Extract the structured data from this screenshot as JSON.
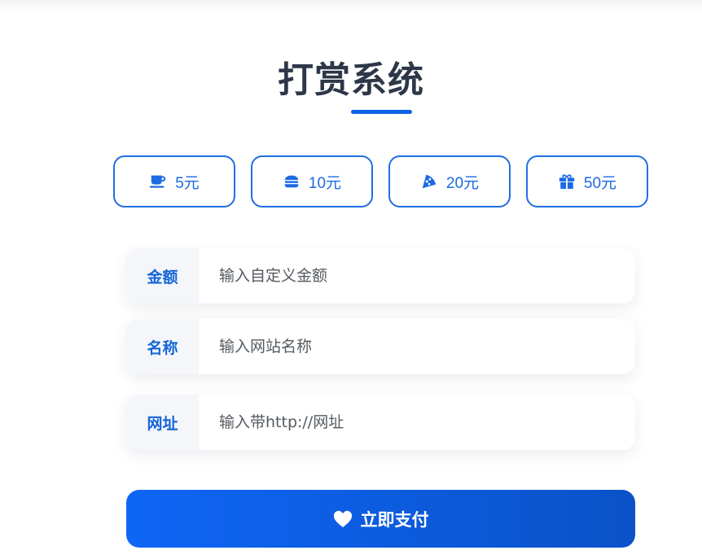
{
  "header": {
    "title": "打赏系统"
  },
  "amounts": [
    {
      "label": "5元",
      "icon": "coffee-icon"
    },
    {
      "label": "10元",
      "icon": "burger-icon"
    },
    {
      "label": "20元",
      "icon": "pizza-icon"
    },
    {
      "label": "50元",
      "icon": "gift-icon"
    }
  ],
  "form": {
    "amount": {
      "label": "金额",
      "placeholder": "输入自定义金额"
    },
    "name": {
      "label": "名称",
      "placeholder": "输入网站名称"
    },
    "url": {
      "label": "网址",
      "placeholder": "输入带http://网址"
    }
  },
  "pay_button": {
    "label": "立即支付",
    "icon": "heart-icon"
  },
  "colors": {
    "accent": "#1d6ae3",
    "title": "#2d3748",
    "button_start": "#0e66f5",
    "button_end": "#0b52c8"
  }
}
